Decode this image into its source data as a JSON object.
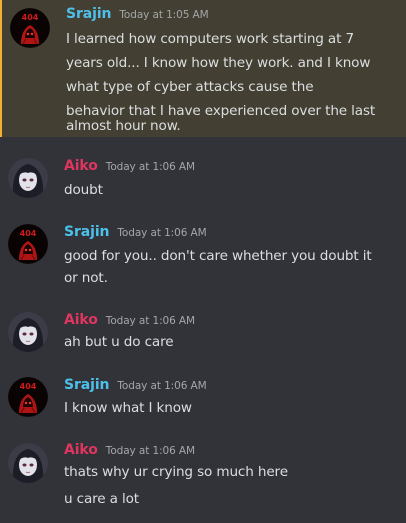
{
  "colors": {
    "background": "#313338",
    "highlight_background": "#433f32",
    "highlight_border": "#f0b232",
    "srajin_name": "#4dc0ea",
    "aiko_name": "#e0355f",
    "text": "#dbdee1",
    "timestamp": "#a3a6aa"
  },
  "messages": [
    {
      "author": "Srajin",
      "avatar_icon": "red-404-hooded-figure-avatar",
      "time": "Today at 1:05 AM",
      "highlighted": true,
      "lines": [
        "I learned how computers work starting at 7",
        "years old... I know how they work. and I know",
        "what type of cyber attacks cause the",
        "behavior that I have experienced over the last",
        "almost hour now."
      ]
    },
    {
      "author": "Aiko",
      "avatar_icon": "anime-girl-avatar",
      "time": "Today at 1:06 AM",
      "lines": [
        "doubt"
      ]
    },
    {
      "author": "Srajin",
      "avatar_icon": "red-404-hooded-figure-avatar",
      "time": "Today at 1:06 AM",
      "lines": [
        "good for you.. don't care whether you doubt it",
        "or not."
      ]
    },
    {
      "author": "Aiko",
      "avatar_icon": "anime-girl-avatar",
      "time": "Today at 1:06 AM",
      "lines": [
        "ah but u do care"
      ]
    },
    {
      "author": "Srajin",
      "avatar_icon": "red-404-hooded-figure-avatar",
      "time": "Today at 1:06 AM",
      "lines": [
        "I know what I know"
      ]
    },
    {
      "author": "Aiko",
      "avatar_icon": "anime-girl-avatar",
      "time": "Today at 1:06 AM",
      "lines": [
        "thats why ur crying so much here"
      ],
      "followup": [
        "u care a lot"
      ]
    }
  ]
}
